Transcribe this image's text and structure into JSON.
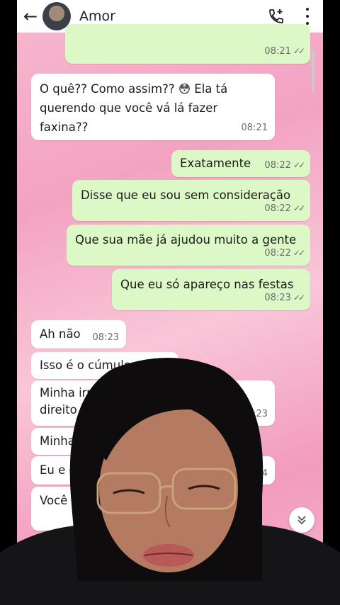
{
  "header": {
    "title": "Amor"
  },
  "icons": {
    "back": "arrow-left-icon",
    "call": "phone-add-icon",
    "more": "more-vertical-icon",
    "scroll": "double-chevron-down-icon"
  },
  "colors": {
    "outgoing": "#dcf8c6",
    "incoming": "#ffffff",
    "wallpaper": "#f3a3c2"
  },
  "messages": [
    {
      "dir": "out",
      "text": "",
      "time": "08:21",
      "ticks": "✓✓"
    },
    {
      "dir": "in",
      "text": "O quê?? Como assim?? 😳 Ela tá querendo que você vá lá fazer faxina??",
      "time": "08:21"
    },
    {
      "dir": "out",
      "text": "Exatamente",
      "time": "08:22",
      "ticks": "✓✓"
    },
    {
      "dir": "out",
      "text": "Disse que eu sou sem consideração",
      "time": "08:22",
      "ticks": "✓✓"
    },
    {
      "dir": "out",
      "text": "Que sua mãe já ajudou muito a gente",
      "time": "08:22",
      "ticks": "✓✓"
    },
    {
      "dir": "out",
      "text": "Que eu só apareço nas festas",
      "time": "08:23",
      "ticks": "✓✓"
    },
    {
      "dir": "in",
      "text": "Ah não",
      "time": "08:23"
    },
    {
      "dir": "in",
      "text": "Isso é o cúmulo",
      "time": ""
    },
    {
      "dir": "in",
      "text": "Minha irm",
      "text2": "direito d",
      "time": "08:23"
    },
    {
      "dir": "in",
      "text": "Minha",
      "time": ""
    },
    {
      "dir": "in",
      "text": "Eu e ela",
      "time": "8:24"
    },
    {
      "dir": "in",
      "text": "Você n",
      "time": ""
    }
  ]
}
